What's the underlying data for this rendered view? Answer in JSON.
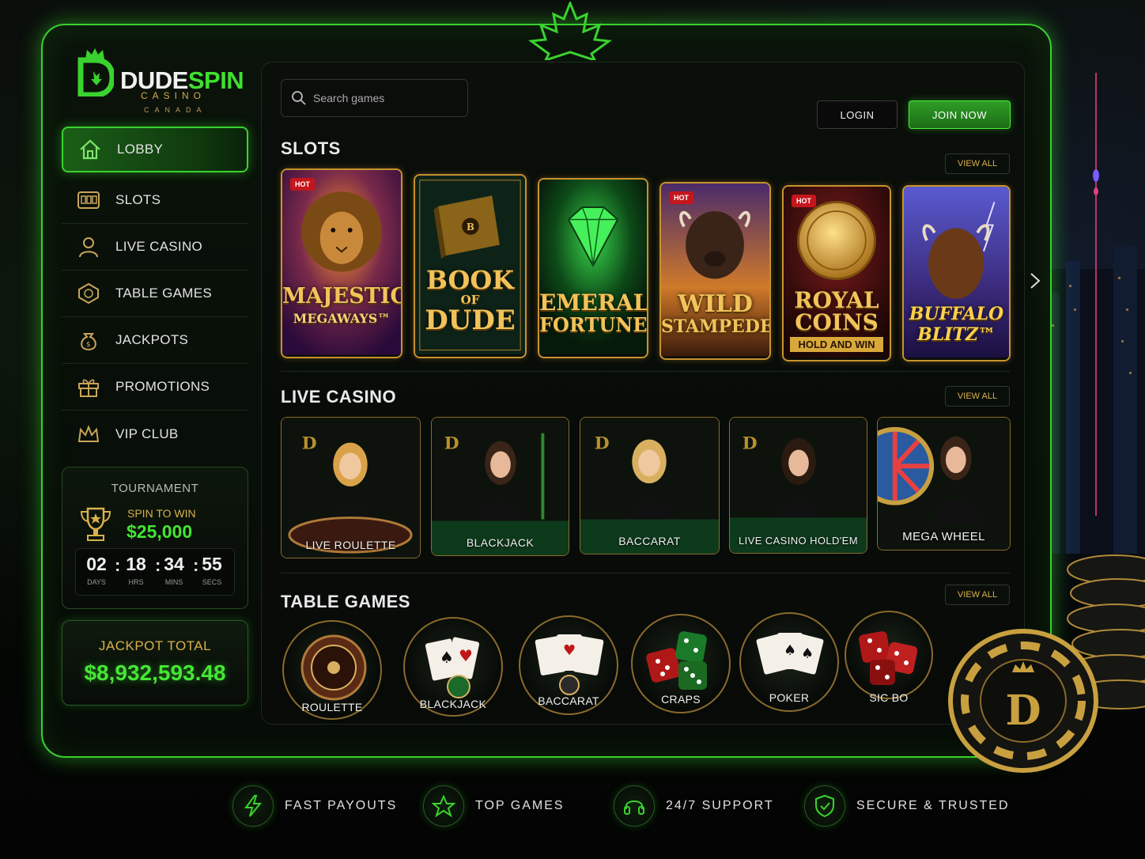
{
  "brand": {
    "name_part1": "DUDE",
    "name_part2": "SPIN",
    "subtitle": "CASINO",
    "region": "CANADA",
    "accent": "#3ad22f",
    "gold": "#d8b14a"
  },
  "search": {
    "placeholder": "Search games"
  },
  "header": {
    "login_label": "LOGIN",
    "join_label": "JOIN NOW"
  },
  "nav": {
    "items": [
      {
        "label": "LOBBY",
        "icon": "home-icon",
        "active": true
      },
      {
        "label": "SLOTS",
        "icon": "slot-machine-icon"
      },
      {
        "label": "LIVE CASINO",
        "icon": "dealer-icon"
      },
      {
        "label": "TABLE GAMES",
        "icon": "chip-icon"
      },
      {
        "label": "JACKPOTS",
        "icon": "money-bag-icon"
      },
      {
        "label": "PROMOTIONS",
        "icon": "gift-icon"
      },
      {
        "label": "VIP CLUB",
        "icon": "crown-icon"
      }
    ]
  },
  "tournament": {
    "title": "TOURNAMENT",
    "subtitle": "SPIN TO WIN",
    "prize": "$25,000",
    "countdown": [
      {
        "value": "02",
        "unit": "DAYS"
      },
      {
        "value": "18",
        "unit": "HRS"
      },
      {
        "value": "34",
        "unit": "MINS"
      },
      {
        "value": "55",
        "unit": "SECS"
      }
    ]
  },
  "jackpot": {
    "title": "JACKPOT TOTAL",
    "amount": "$8,932,593.48"
  },
  "slots": {
    "title": "SLOTS",
    "view_all": "VIEW ALL",
    "games": [
      {
        "line1": "MAJESTIC",
        "line2": "MEGAWAYS™",
        "hot": true
      },
      {
        "line1": "BOOK",
        "line2": "OF",
        "line3": "DUDE",
        "hot": false
      },
      {
        "line1": "EMERALD",
        "line2": "FORTUNE",
        "hot": false
      },
      {
        "line1": "WILD",
        "line2": "STAMPEDE",
        "hot": true
      },
      {
        "line1": "ROYAL",
        "line2": "COINS",
        "line3": "HOLD AND WIN",
        "hot": true
      },
      {
        "line1": "BUFFALO",
        "line2": "BLITZ™",
        "hot": false
      }
    ],
    "hot_label": "HOT"
  },
  "live_casino": {
    "title": "LIVE CASINO",
    "view_all": "VIEW ALL",
    "games": [
      "LIVE ROULETTE",
      "BLACKJACK",
      "BACCARAT",
      "LIVE CASINO HOLD'EM",
      "MEGA WHEEL"
    ]
  },
  "table_games": {
    "title": "TABLE GAMES",
    "view_all": "VIEW ALL",
    "games": [
      "ROULETTE",
      "BLACKJACK",
      "BACCARAT",
      "CRAPS",
      "POKER",
      "SIC BO"
    ]
  },
  "features": [
    {
      "label": "FAST PAYOUTS",
      "icon": "lightning-icon"
    },
    {
      "label": "TOP GAMES",
      "icon": "star-icon"
    },
    {
      "label": "24/7 SUPPORT",
      "icon": "headset-icon"
    },
    {
      "label": "SECURE & TRUSTED",
      "icon": "shield-check-icon"
    }
  ]
}
